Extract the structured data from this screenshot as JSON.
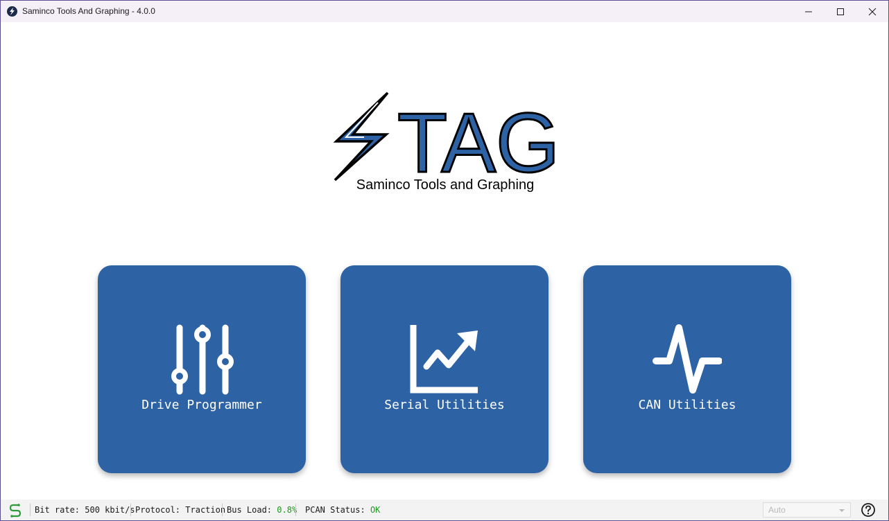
{
  "window": {
    "title": "Saminco Tools And Graphing - 4.0.0",
    "app_icon": "lightning-bolt-icon",
    "controls": {
      "minimize": "minimize-icon",
      "maximize": "maximize-icon",
      "close": "close-icon"
    }
  },
  "logo": {
    "word": "TAG",
    "subtitle": "Saminco Tools and Graphing",
    "colors": {
      "fill": "#2d63a4",
      "outline": "#000000"
    }
  },
  "tiles": [
    {
      "label": "Drive Programmer",
      "icon": "sliders-icon"
    },
    {
      "label": "Serial Utilities",
      "icon": "line-chart-icon"
    },
    {
      "label": "CAN Utilities",
      "icon": "waveform-icon"
    }
  ],
  "statusbar": {
    "icon": "cable-icon",
    "bitrate_label": "Bit rate:",
    "bitrate_value": "500 kbit/s",
    "protocol_label": "Protocol:",
    "protocol_value": "Traction",
    "busload_label": "Bus Load:",
    "busload_value": "0.8%",
    "pcan_label": "PCAN Status:",
    "pcan_value": "OK",
    "mode_value": "Auto",
    "help_icon": "help-icon"
  },
  "colors": {
    "tile_bg": "#2d63a4",
    "titlebar_bg": "#f5eff8",
    "status_ok": "#1a9a1a"
  }
}
